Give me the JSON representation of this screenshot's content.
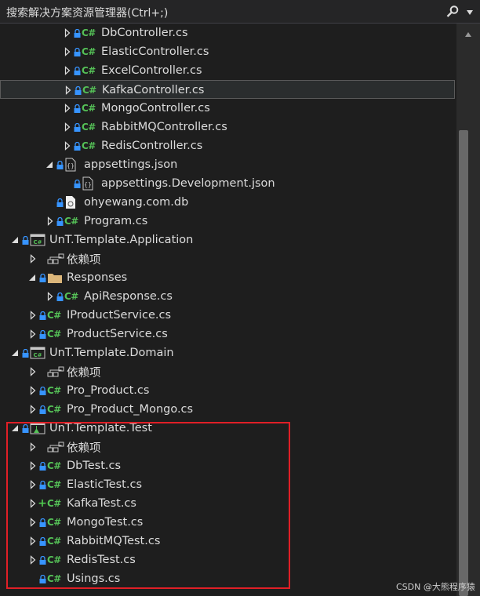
{
  "search": {
    "placeholder": "搜索解决方案资源管理器(Ctrl+;)"
  },
  "tree": [
    {
      "label": "DbController.cs",
      "depth": 3,
      "icon": "csharp-file-icon",
      "expander": "collapsed",
      "marker": "lock"
    },
    {
      "label": "ElasticController.cs",
      "depth": 3,
      "icon": "csharp-file-icon",
      "expander": "collapsed",
      "marker": "lock"
    },
    {
      "label": "ExcelController.cs",
      "depth": 3,
      "icon": "csharp-file-icon",
      "expander": "collapsed",
      "marker": "lock"
    },
    {
      "label": "KafkaController.cs",
      "depth": 3,
      "icon": "csharp-file-icon",
      "expander": "collapsed",
      "marker": "lock",
      "selected": true
    },
    {
      "label": "MongoController.cs",
      "depth": 3,
      "icon": "csharp-file-icon",
      "expander": "collapsed",
      "marker": "lock"
    },
    {
      "label": "RabbitMQController.cs",
      "depth": 3,
      "icon": "csharp-file-icon",
      "expander": "collapsed",
      "marker": "lock"
    },
    {
      "label": "RedisController.cs",
      "depth": 3,
      "icon": "csharp-file-icon",
      "expander": "collapsed",
      "marker": "lock"
    },
    {
      "label": "appsettings.json",
      "depth": 2,
      "icon": "json-file-icon",
      "expander": "expanded",
      "marker": "lock"
    },
    {
      "label": "appsettings.Development.json",
      "depth": 3,
      "icon": "json-file-icon",
      "expander": "none",
      "marker": "lock"
    },
    {
      "label": "ohyewang.com.db",
      "depth": 2,
      "icon": "db-file-icon",
      "expander": "none",
      "marker": "lock"
    },
    {
      "label": "Program.cs",
      "depth": 2,
      "icon": "csharp-file-icon",
      "expander": "collapsed",
      "marker": "lock"
    },
    {
      "label": "UnT.Template.Application",
      "depth": 0,
      "icon": "csharp-project-icon",
      "expander": "expanded",
      "marker": "lock"
    },
    {
      "label": "依赖项",
      "depth": 1,
      "icon": "dependencies-icon",
      "expander": "collapsed",
      "marker": "none"
    },
    {
      "label": "Responses",
      "depth": 1,
      "icon": "folder-icon",
      "expander": "expanded",
      "marker": "lock"
    },
    {
      "label": "ApiResponse.cs",
      "depth": 2,
      "icon": "csharp-file-icon",
      "expander": "collapsed",
      "marker": "lock"
    },
    {
      "label": "IProductService.cs",
      "depth": 1,
      "icon": "csharp-file-icon",
      "expander": "collapsed",
      "marker": "lock"
    },
    {
      "label": "ProductService.cs",
      "depth": 1,
      "icon": "csharp-file-icon",
      "expander": "collapsed",
      "marker": "lock"
    },
    {
      "label": "UnT.Template.Domain",
      "depth": 0,
      "icon": "csharp-project-icon",
      "expander": "expanded",
      "marker": "lock"
    },
    {
      "label": "依赖项",
      "depth": 1,
      "icon": "dependencies-icon",
      "expander": "collapsed",
      "marker": "none"
    },
    {
      "label": "Pro_Product.cs",
      "depth": 1,
      "icon": "csharp-file-icon",
      "expander": "collapsed",
      "marker": "lock"
    },
    {
      "label": "Pro_Product_Mongo.cs",
      "depth": 1,
      "icon": "csharp-file-icon",
      "expander": "collapsed",
      "marker": "lock"
    },
    {
      "label": "UnT.Template.Test",
      "depth": 0,
      "icon": "test-project-icon",
      "expander": "expanded",
      "marker": "lock"
    },
    {
      "label": "依赖项",
      "depth": 1,
      "icon": "dependencies-icon",
      "expander": "collapsed",
      "marker": "none"
    },
    {
      "label": "DbTest.cs",
      "depth": 1,
      "icon": "csharp-file-icon",
      "expander": "collapsed",
      "marker": "lock"
    },
    {
      "label": "ElasticTest.cs",
      "depth": 1,
      "icon": "csharp-file-icon",
      "expander": "collapsed",
      "marker": "lock"
    },
    {
      "label": "KafkaTest.cs",
      "depth": 1,
      "icon": "csharp-file-icon",
      "expander": "collapsed",
      "marker": "plus"
    },
    {
      "label": "MongoTest.cs",
      "depth": 1,
      "icon": "csharp-file-icon",
      "expander": "collapsed",
      "marker": "lock"
    },
    {
      "label": "RabbitMQTest.cs",
      "depth": 1,
      "icon": "csharp-file-icon",
      "expander": "collapsed",
      "marker": "lock"
    },
    {
      "label": "RedisTest.cs",
      "depth": 1,
      "icon": "csharp-file-icon",
      "expander": "collapsed",
      "marker": "lock"
    },
    {
      "label": "Usings.cs",
      "depth": 1,
      "icon": "csharp-file-icon",
      "expander": "none",
      "marker": "lock"
    }
  ],
  "watermark": "CSDN @大熊程序猿",
  "colors": {
    "background": "#1e1e1e",
    "csharp": "#55c157",
    "highlight": "#e01f26",
    "lock": "#3794ff",
    "selection": "#2a2d2e"
  }
}
